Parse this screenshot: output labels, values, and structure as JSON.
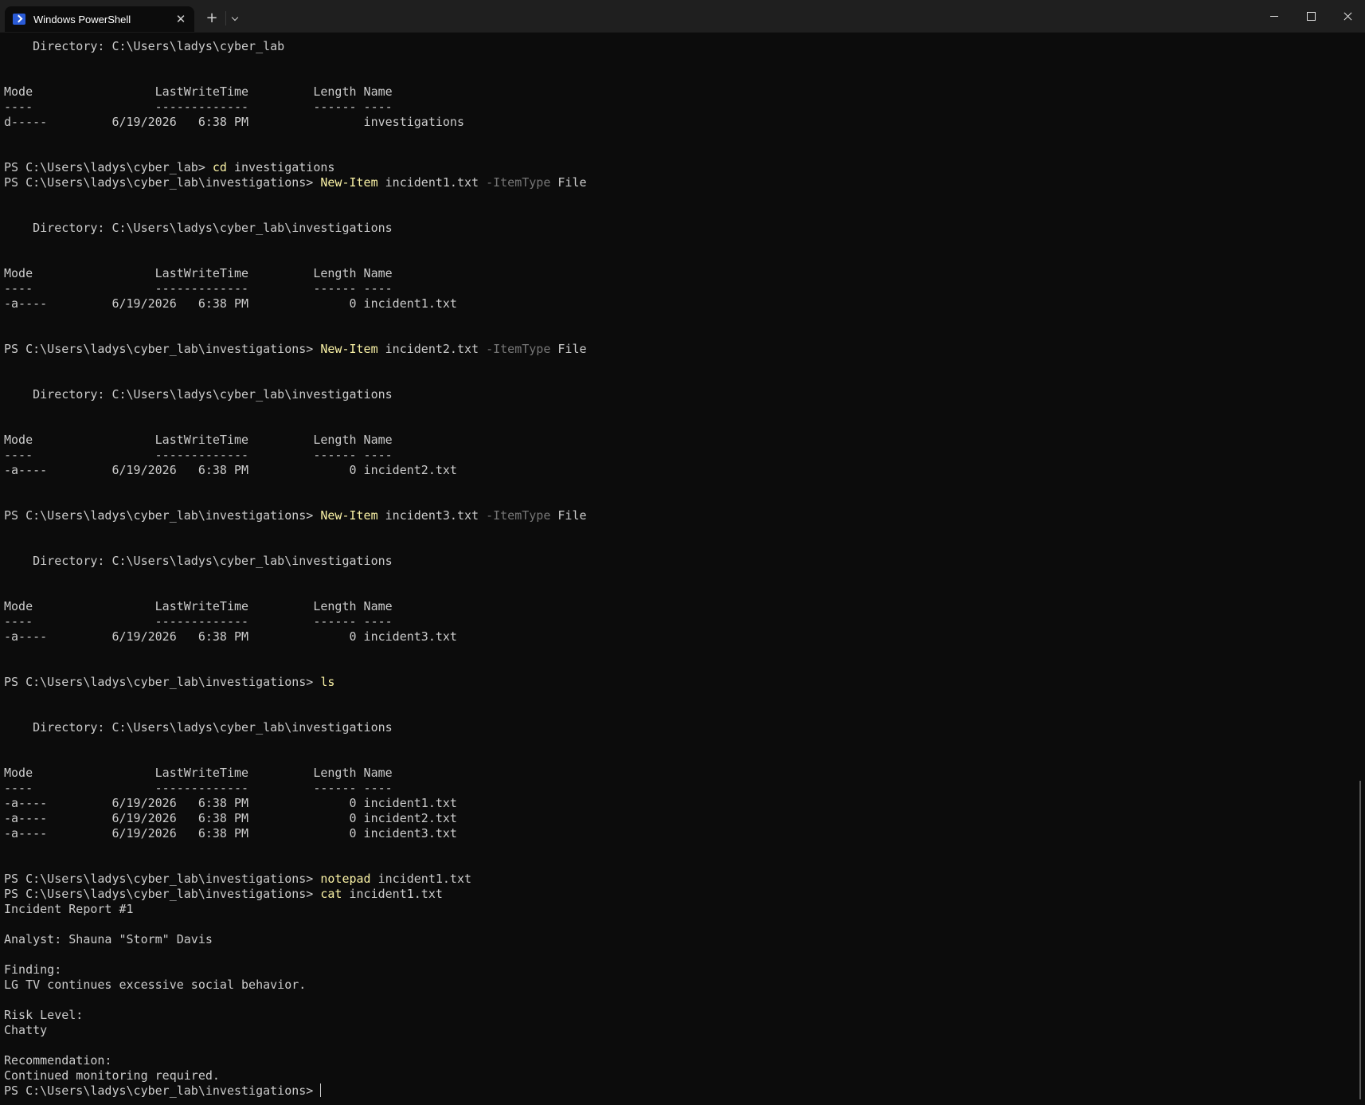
{
  "window": {
    "tab_title": "Windows PowerShell",
    "tab_close_glyph": "✕",
    "new_tab_glyph": "+"
  },
  "terminal": {
    "lines": [
      {
        "segments": [
          {
            "t": "    Directory: C:\\Users\\ladys\\cyber_lab"
          }
        ]
      },
      {
        "segments": []
      },
      {
        "segments": []
      },
      {
        "segments": [
          {
            "t": "Mode                 LastWriteTime         Length Name"
          }
        ]
      },
      {
        "segments": [
          {
            "t": "----                 -------------         ------ ----"
          }
        ]
      },
      {
        "segments": [
          {
            "t": "d-----         6/19/2026   6:38 PM                investigations"
          }
        ]
      },
      {
        "segments": []
      },
      {
        "segments": []
      },
      {
        "segments": [
          {
            "t": "PS C:\\Users\\ladys\\cyber_lab> "
          },
          {
            "t": "cd",
            "c": "cmd"
          },
          {
            "t": " investigations"
          }
        ]
      },
      {
        "segments": [
          {
            "t": "PS C:\\Users\\ladys\\cyber_lab\\investigations> "
          },
          {
            "t": "New-Item",
            "c": "cmd"
          },
          {
            "t": " incident1.txt "
          },
          {
            "t": "-ItemType",
            "c": "param"
          },
          {
            "t": " File"
          }
        ]
      },
      {
        "segments": []
      },
      {
        "segments": []
      },
      {
        "segments": [
          {
            "t": "    Directory: C:\\Users\\ladys\\cyber_lab\\investigations"
          }
        ]
      },
      {
        "segments": []
      },
      {
        "segments": []
      },
      {
        "segments": [
          {
            "t": "Mode                 LastWriteTime         Length Name"
          }
        ]
      },
      {
        "segments": [
          {
            "t": "----                 -------------         ------ ----"
          }
        ]
      },
      {
        "segments": [
          {
            "t": "-a----         6/19/2026   6:38 PM              0 incident1.txt"
          }
        ]
      },
      {
        "segments": []
      },
      {
        "segments": []
      },
      {
        "segments": [
          {
            "t": "PS C:\\Users\\ladys\\cyber_lab\\investigations> "
          },
          {
            "t": "New-Item",
            "c": "cmd"
          },
          {
            "t": " incident2.txt "
          },
          {
            "t": "-ItemType",
            "c": "param"
          },
          {
            "t": " File"
          }
        ]
      },
      {
        "segments": []
      },
      {
        "segments": []
      },
      {
        "segments": [
          {
            "t": "    Directory: C:\\Users\\ladys\\cyber_lab\\investigations"
          }
        ]
      },
      {
        "segments": []
      },
      {
        "segments": []
      },
      {
        "segments": [
          {
            "t": "Mode                 LastWriteTime         Length Name"
          }
        ]
      },
      {
        "segments": [
          {
            "t": "----                 -------------         ------ ----"
          }
        ]
      },
      {
        "segments": [
          {
            "t": "-a----         6/19/2026   6:38 PM              0 incident2.txt"
          }
        ]
      },
      {
        "segments": []
      },
      {
        "segments": []
      },
      {
        "segments": [
          {
            "t": "PS C:\\Users\\ladys\\cyber_lab\\investigations> "
          },
          {
            "t": "New-Item",
            "c": "cmd"
          },
          {
            "t": " incident3.txt "
          },
          {
            "t": "-ItemType",
            "c": "param"
          },
          {
            "t": " File"
          }
        ]
      },
      {
        "segments": []
      },
      {
        "segments": []
      },
      {
        "segments": [
          {
            "t": "    Directory: C:\\Users\\ladys\\cyber_lab\\investigations"
          }
        ]
      },
      {
        "segments": []
      },
      {
        "segments": []
      },
      {
        "segments": [
          {
            "t": "Mode                 LastWriteTime         Length Name"
          }
        ]
      },
      {
        "segments": [
          {
            "t": "----                 -------------         ------ ----"
          }
        ]
      },
      {
        "segments": [
          {
            "t": "-a----         6/19/2026   6:38 PM              0 incident3.txt"
          }
        ]
      },
      {
        "segments": []
      },
      {
        "segments": []
      },
      {
        "segments": [
          {
            "t": "PS C:\\Users\\ladys\\cyber_lab\\investigations> "
          },
          {
            "t": "ls",
            "c": "cmd"
          }
        ]
      },
      {
        "segments": []
      },
      {
        "segments": []
      },
      {
        "segments": [
          {
            "t": "    Directory: C:\\Users\\ladys\\cyber_lab\\investigations"
          }
        ]
      },
      {
        "segments": []
      },
      {
        "segments": []
      },
      {
        "segments": [
          {
            "t": "Mode                 LastWriteTime         Length Name"
          }
        ]
      },
      {
        "segments": [
          {
            "t": "----                 -------------         ------ ----"
          }
        ]
      },
      {
        "segments": [
          {
            "t": "-a----         6/19/2026   6:38 PM              0 incident1.txt"
          }
        ]
      },
      {
        "segments": [
          {
            "t": "-a----         6/19/2026   6:38 PM              0 incident2.txt"
          }
        ]
      },
      {
        "segments": [
          {
            "t": "-a----         6/19/2026   6:38 PM              0 incident3.txt"
          }
        ]
      },
      {
        "segments": []
      },
      {
        "segments": []
      },
      {
        "segments": [
          {
            "t": "PS C:\\Users\\ladys\\cyber_lab\\investigations> "
          },
          {
            "t": "notepad",
            "c": "cmd"
          },
          {
            "t": " incident1.txt"
          }
        ]
      },
      {
        "segments": [
          {
            "t": "PS C:\\Users\\ladys\\cyber_lab\\investigations> "
          },
          {
            "t": "cat",
            "c": "cmd"
          },
          {
            "t": " incident1.txt"
          }
        ]
      },
      {
        "segments": [
          {
            "t": "Incident Report #1"
          }
        ]
      },
      {
        "segments": []
      },
      {
        "segments": [
          {
            "t": "Analyst: Shauna \"Storm\" Davis"
          }
        ]
      },
      {
        "segments": []
      },
      {
        "segments": [
          {
            "t": "Finding:"
          }
        ]
      },
      {
        "segments": [
          {
            "t": "LG TV continues excessive social behavior."
          }
        ]
      },
      {
        "segments": []
      },
      {
        "segments": [
          {
            "t": "Risk Level:"
          }
        ]
      },
      {
        "segments": [
          {
            "t": "Chatty"
          }
        ]
      },
      {
        "segments": []
      },
      {
        "segments": [
          {
            "t": "Recommendation:"
          }
        ]
      },
      {
        "segments": [
          {
            "t": "Continued monitoring required."
          }
        ]
      },
      {
        "segments": [
          {
            "t": "PS C:\\Users\\ladys\\cyber_lab\\investigations> "
          }
        ],
        "cursor": true
      }
    ]
  },
  "colors": {
    "background": "#0c0c0c",
    "foreground": "#cccccc",
    "command": "#f9f1a5",
    "parameter": "#767676",
    "titlebar": "#1f1f1f"
  }
}
